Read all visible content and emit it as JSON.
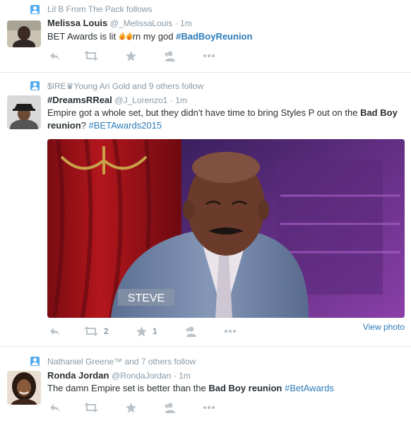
{
  "tweets": [
    {
      "context": "Lil B From The Pack follows",
      "name": "Melissa Louis",
      "handle": "@_MelissaLouis",
      "time": "· 1m",
      "text_a": "BET Awards is lit ",
      "text_b": "rn my god ",
      "hashtag": "#BadBoyReunion",
      "emoji": [
        "fire",
        "fire"
      ],
      "actions": {
        "reply": "reply-icon",
        "retweet": "retweet-icon",
        "favorite": "star-icon",
        "follow": "follow-icon",
        "more": "more-icon"
      }
    },
    {
      "context": "$IRE♛Young Ari Gold and 9 others follow",
      "name": "#DreamsRReal",
      "handle": "@J_Lorenzo1",
      "time": "· 1m",
      "text_a": "Empire got a whole set, but they didn't have time to bring Styles P out on the ",
      "text_bold": "Bad Boy reunion",
      "text_b": "? ",
      "hashtag": "#BETAwards2015",
      "photo_caption": "STEVE",
      "retweets": "2",
      "favorites": "1",
      "view_photo": "View photo"
    },
    {
      "context": "Nathaniel Greene™ and 7 others follow",
      "name": "Ronda Jordan",
      "handle": "@RondaJordan",
      "time": "· 1m",
      "text_a": "The damn Empire set is better than the ",
      "text_bold": "Bad Boy reunion",
      "text_b": " ",
      "hashtag": "#BetAwards"
    }
  ],
  "colors": {
    "accent": "#2b7bb9",
    "muted": "#8899a6",
    "icon": "#bbc3c9",
    "border": "#e1e8ed",
    "context_icon": "#55acee"
  }
}
